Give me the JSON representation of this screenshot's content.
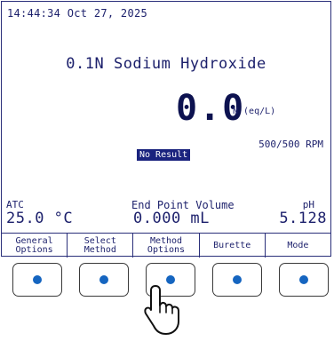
{
  "status": {
    "datetime": "14:44:34 Oct 27, 2025"
  },
  "main": {
    "reagent": "0.1N Sodium Hydroxide",
    "concentration_value": "0.0",
    "concentration_unit": "N (eq/L)",
    "stirrer_speed": "500/500 RPM",
    "result_badge": "No Result"
  },
  "readouts": {
    "atc_label": "ATC",
    "atc_value": "25.0 °C",
    "endpoint_label": "End Point Volume",
    "endpoint_value": "0.000 mL",
    "ph_label": "pH",
    "ph_value": "5.128"
  },
  "softkeys": [
    {
      "line1": "General",
      "line2": "Options"
    },
    {
      "line1": "Select",
      "line2": "Method"
    },
    {
      "line1": "Method",
      "line2": "Options"
    },
    {
      "line1": "Burette",
      "line2": ""
    },
    {
      "line1": "Mode",
      "line2": ""
    }
  ],
  "colors": {
    "screen_text": "#1b1f6b",
    "button_dot": "#1565c0",
    "badge_bg": "#1a237e"
  },
  "icons": {
    "pointer": "pointing-hand-icon"
  }
}
